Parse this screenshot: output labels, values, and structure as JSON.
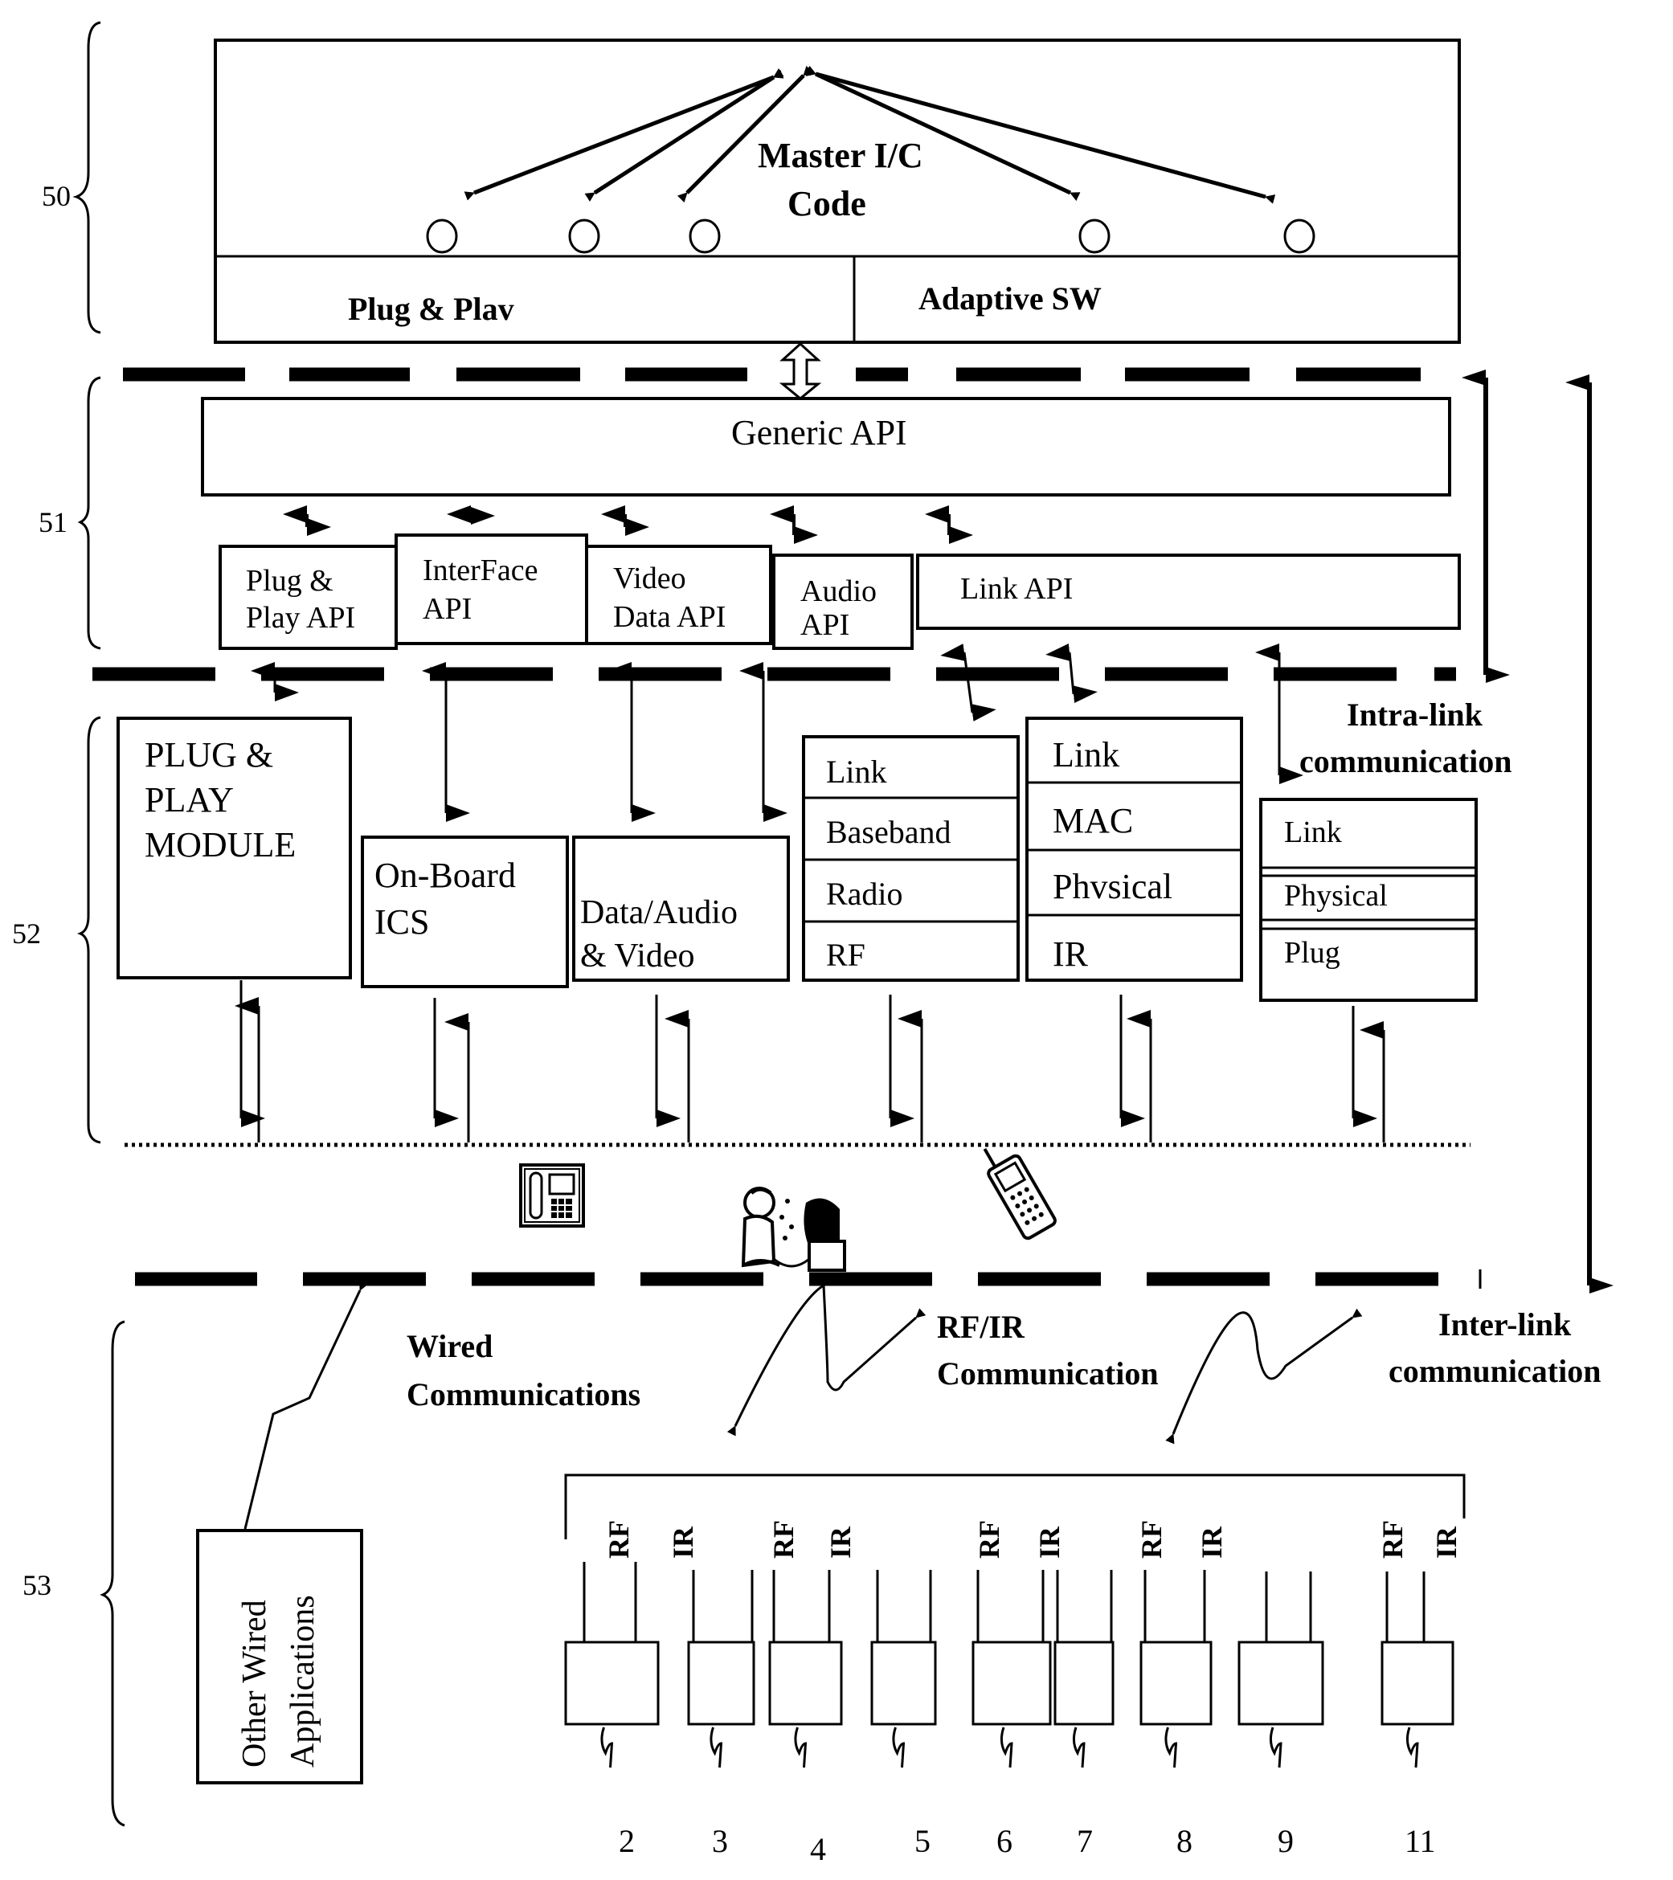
{
  "layers": {
    "l50": "50",
    "l51": "51",
    "l52": "52",
    "l53": "53"
  },
  "master": {
    "title_line1": "Master I/C",
    "title_line2": "Code",
    "plug_play": "Plug & Plav",
    "adaptive_sw": "Adaptive SW"
  },
  "generic_api": "Generic API",
  "apis": {
    "plug_play_api": [
      "Plug &",
      "Play API"
    ],
    "interface_api": [
      "InterFace",
      "API"
    ],
    "video_data_api": [
      "Video",
      "Data API"
    ],
    "audio_api": [
      "Audio",
      "API"
    ],
    "link_api": "Link API"
  },
  "modules": {
    "plug_play_module": [
      "PLUG &",
      "PLAY",
      "MODULE"
    ],
    "onboard_ics": [
      "On-Board",
      "ICS"
    ],
    "data_audio_video": [
      "Data/Audio",
      "& Video"
    ]
  },
  "stacks": {
    "rf_stack": [
      "Link",
      "Baseband",
      "Radio",
      "RF"
    ],
    "ir_stack": [
      "Link",
      "MAC",
      "Phvsical",
      "IR"
    ],
    "plug_stack": [
      "Link",
      "Physical",
      "Plug"
    ]
  },
  "labels": {
    "intra_link": [
      "Intra-link",
      "communication"
    ],
    "inter_link": [
      "Inter-link",
      "communication"
    ],
    "wired": [
      "Wired",
      "Communications"
    ],
    "rfir": [
      "RF/IR",
      "Communication"
    ],
    "other_wired": [
      "Other Wired",
      "Applications"
    ]
  },
  "icons": [
    "wall-phone-icon",
    "person-computer-icon",
    "mobile-phone-icon"
  ],
  "devices": {
    "port_labels": [
      "RF",
      "IR"
    ],
    "numbers": [
      "2",
      "3",
      "4",
      "5",
      "6",
      "7",
      "8",
      "9",
      "11"
    ]
  }
}
